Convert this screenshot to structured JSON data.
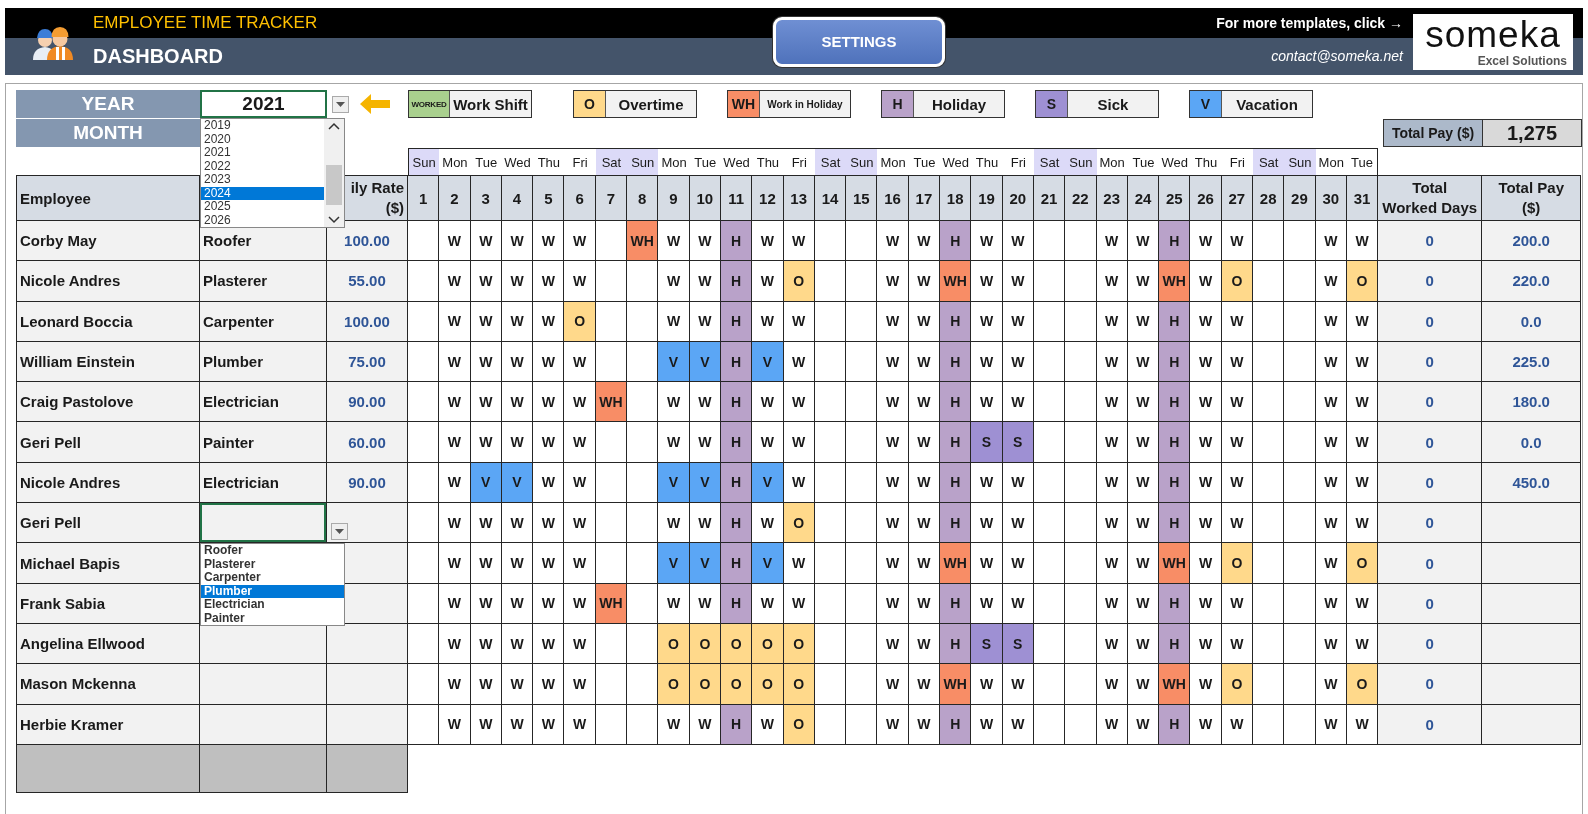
{
  "header": {
    "title": "EMPLOYEE TIME TRACKER",
    "subtitle": "DASHBOARD",
    "settings_button": "SETTINGS",
    "templates_link": "For more templates, click →",
    "contact": "contact@someka.net",
    "logo": {
      "name": "someka",
      "tagline": "Excel Solutions"
    }
  },
  "filters": {
    "year_label": "YEAR",
    "year_value": "2021",
    "month_label": "MONTH",
    "year_dropdown": {
      "options": [
        {
          "label": "2019",
          "selected": false
        },
        {
          "label": "2020",
          "selected": false
        },
        {
          "label": "2021",
          "selected": false
        },
        {
          "label": "2022",
          "selected": false
        },
        {
          "label": "2023",
          "selected": false
        },
        {
          "label": "2024",
          "selected": true
        },
        {
          "label": "2025",
          "selected": false
        },
        {
          "label": "2026",
          "selected": false
        }
      ]
    }
  },
  "legend": [
    {
      "kind": "work",
      "code": "WORKED",
      "label": "Work Shift",
      "color": "#a9d08e"
    },
    {
      "kind": "overtime",
      "code": "O",
      "label": "Overtime",
      "color": "#ffd98b"
    },
    {
      "kind": "work_holiday",
      "code": "WH",
      "label": "Work in Holiday",
      "color": "#f88d66"
    },
    {
      "kind": "holiday",
      "code": "H",
      "label": "Holiday",
      "color": "#b9a2c9"
    },
    {
      "kind": "sick",
      "code": "S",
      "label": "Sick",
      "color": "#9e90d3"
    },
    {
      "kind": "vacation",
      "code": "V",
      "label": "Vacation",
      "color": "#5ba6f5"
    }
  ],
  "total_pay": {
    "label": "Total Pay ($)",
    "value": "1,275"
  },
  "table": {
    "columns": {
      "employee": "Employee",
      "daily_rate": [
        "ily Rate",
        "($)"
      ],
      "total_worked_days": [
        "Total",
        "Worked Days"
      ],
      "total_pay": [
        "Total Pay",
        "($)"
      ]
    },
    "days": [
      {
        "weekday": "Sun",
        "number": "1",
        "weekend": true
      },
      {
        "weekday": "Mon",
        "number": "2",
        "weekend": false
      },
      {
        "weekday": "Tue",
        "number": "3",
        "weekend": false
      },
      {
        "weekday": "Wed",
        "number": "4",
        "weekend": false
      },
      {
        "weekday": "Thu",
        "number": "5",
        "weekend": false
      },
      {
        "weekday": "Fri",
        "number": "6",
        "weekend": false
      },
      {
        "weekday": "Sat",
        "number": "7",
        "weekend": true
      },
      {
        "weekday": "Sun",
        "number": "8",
        "weekend": true
      },
      {
        "weekday": "Mon",
        "number": "9",
        "weekend": false
      },
      {
        "weekday": "Tue",
        "number": "10",
        "weekend": false
      },
      {
        "weekday": "Wed",
        "number": "11",
        "weekend": false
      },
      {
        "weekday": "Thu",
        "number": "12",
        "weekend": false
      },
      {
        "weekday": "Fri",
        "number": "13",
        "weekend": false
      },
      {
        "weekday": "Sat",
        "number": "14",
        "weekend": true
      },
      {
        "weekday": "Sun",
        "number": "15",
        "weekend": true
      },
      {
        "weekday": "Mon",
        "number": "16",
        "weekend": false
      },
      {
        "weekday": "Tue",
        "number": "17",
        "weekend": false
      },
      {
        "weekday": "Wed",
        "number": "18",
        "weekend": false
      },
      {
        "weekday": "Thu",
        "number": "19",
        "weekend": false
      },
      {
        "weekday": "Fri",
        "number": "20",
        "weekend": false
      },
      {
        "weekday": "Sat",
        "number": "21",
        "weekend": true
      },
      {
        "weekday": "Sun",
        "number": "22",
        "weekend": true
      },
      {
        "weekday": "Mon",
        "number": "23",
        "weekend": false
      },
      {
        "weekday": "Tue",
        "number": "24",
        "weekend": false
      },
      {
        "weekday": "Wed",
        "number": "25",
        "weekend": false
      },
      {
        "weekday": "Thu",
        "number": "26",
        "weekend": false
      },
      {
        "weekday": "Fri",
        "number": "27",
        "weekend": false
      },
      {
        "weekday": "Sat",
        "number": "28",
        "weekend": true
      },
      {
        "weekday": "Sun",
        "number": "29",
        "weekend": true
      },
      {
        "weekday": "Mon",
        "number": "30",
        "weekend": false
      },
      {
        "weekday": "Tue",
        "number": "31",
        "weekend": false
      }
    ],
    "rows": [
      {
        "employee": "Corby May",
        "job": "Roofer",
        "daily_rate": "100.00",
        "total_worked_days": "0",
        "total_pay": "200.0",
        "days": [
          {
            "kind": "empty"
          },
          {
            "kind": "work",
            "text": "W"
          },
          {
            "kind": "work",
            "text": "W"
          },
          {
            "kind": "work",
            "text": "W"
          },
          {
            "kind": "work",
            "text": "W"
          },
          {
            "kind": "work",
            "text": "W"
          },
          {
            "kind": "empty"
          },
          {
            "kind": "work_holiday",
            "text": "WH"
          },
          {
            "kind": "work",
            "text": "W"
          },
          {
            "kind": "work",
            "text": "W"
          },
          {
            "kind": "holiday",
            "text": "H"
          },
          {
            "kind": "work",
            "text": "W"
          },
          {
            "kind": "work",
            "text": "W"
          },
          {
            "kind": "empty"
          },
          {
            "kind": "empty"
          },
          {
            "kind": "work",
            "text": "W"
          },
          {
            "kind": "work",
            "text": "W"
          },
          {
            "kind": "holiday",
            "text": "H"
          },
          {
            "kind": "work",
            "text": "W"
          },
          {
            "kind": "work",
            "text": "W"
          },
          {
            "kind": "empty"
          },
          {
            "kind": "empty"
          },
          {
            "kind": "work",
            "text": "W"
          },
          {
            "kind": "work",
            "text": "W"
          },
          {
            "kind": "holiday",
            "text": "H"
          },
          {
            "kind": "work",
            "text": "W"
          },
          {
            "kind": "work",
            "text": "W"
          },
          {
            "kind": "empty"
          },
          {
            "kind": "empty"
          },
          {
            "kind": "work",
            "text": "W"
          },
          {
            "kind": "work",
            "text": "W"
          }
        ]
      },
      {
        "employee": "Nicole Andres",
        "job": "Plasterer",
        "daily_rate": "55.00",
        "total_worked_days": "0",
        "total_pay": "220.0",
        "days": [
          {
            "kind": "empty"
          },
          {
            "kind": "work",
            "text": "W"
          },
          {
            "kind": "work",
            "text": "W"
          },
          {
            "kind": "work",
            "text": "W"
          },
          {
            "kind": "work",
            "text": "W"
          },
          {
            "kind": "work",
            "text": "W"
          },
          {
            "kind": "empty"
          },
          {
            "kind": "empty"
          },
          {
            "kind": "work",
            "text": "W"
          },
          {
            "kind": "work",
            "text": "W"
          },
          {
            "kind": "holiday",
            "text": "H"
          },
          {
            "kind": "work",
            "text": "W"
          },
          {
            "kind": "overtime",
            "text": "O"
          },
          {
            "kind": "empty"
          },
          {
            "kind": "empty"
          },
          {
            "kind": "work",
            "text": "W"
          },
          {
            "kind": "work",
            "text": "W"
          },
          {
            "kind": "work_holiday",
            "text": "WH"
          },
          {
            "kind": "work",
            "text": "W"
          },
          {
            "kind": "work",
            "text": "W"
          },
          {
            "kind": "empty"
          },
          {
            "kind": "empty"
          },
          {
            "kind": "work",
            "text": "W"
          },
          {
            "kind": "work",
            "text": "W"
          },
          {
            "kind": "work_holiday",
            "text": "WH"
          },
          {
            "kind": "work",
            "text": "W"
          },
          {
            "kind": "overtime",
            "text": "O"
          },
          {
            "kind": "empty"
          },
          {
            "kind": "empty"
          },
          {
            "kind": "work",
            "text": "W"
          },
          {
            "kind": "overtime",
            "text": "O"
          }
        ]
      },
      {
        "employee": "Leonard Boccia",
        "job": "Carpenter",
        "daily_rate": "100.00",
        "total_worked_days": "0",
        "total_pay": "0.0",
        "days": [
          {
            "kind": "empty"
          },
          {
            "kind": "work",
            "text": "W"
          },
          {
            "kind": "work",
            "text": "W"
          },
          {
            "kind": "work",
            "text": "W"
          },
          {
            "kind": "work",
            "text": "W"
          },
          {
            "kind": "overtime",
            "text": "O"
          },
          {
            "kind": "empty"
          },
          {
            "kind": "empty"
          },
          {
            "kind": "work",
            "text": "W"
          },
          {
            "kind": "work",
            "text": "W"
          },
          {
            "kind": "holiday",
            "text": "H"
          },
          {
            "kind": "work",
            "text": "W"
          },
          {
            "kind": "work",
            "text": "W"
          },
          {
            "kind": "empty"
          },
          {
            "kind": "empty"
          },
          {
            "kind": "work",
            "text": "W"
          },
          {
            "kind": "work",
            "text": "W"
          },
          {
            "kind": "holiday",
            "text": "H"
          },
          {
            "kind": "work",
            "text": "W"
          },
          {
            "kind": "work",
            "text": "W"
          },
          {
            "kind": "empty"
          },
          {
            "kind": "empty"
          },
          {
            "kind": "work",
            "text": "W"
          },
          {
            "kind": "work",
            "text": "W"
          },
          {
            "kind": "holiday",
            "text": "H"
          },
          {
            "kind": "work",
            "text": "W"
          },
          {
            "kind": "work",
            "text": "W"
          },
          {
            "kind": "empty"
          },
          {
            "kind": "empty"
          },
          {
            "kind": "work",
            "text": "W"
          },
          {
            "kind": "work",
            "text": "W"
          }
        ]
      },
      {
        "employee": "William Einstein",
        "job": "Plumber",
        "daily_rate": "75.00",
        "total_worked_days": "0",
        "total_pay": "225.0",
        "days": [
          {
            "kind": "empty"
          },
          {
            "kind": "work",
            "text": "W"
          },
          {
            "kind": "work",
            "text": "W"
          },
          {
            "kind": "work",
            "text": "W"
          },
          {
            "kind": "work",
            "text": "W"
          },
          {
            "kind": "work",
            "text": "W"
          },
          {
            "kind": "empty"
          },
          {
            "kind": "empty"
          },
          {
            "kind": "vacation",
            "text": "V"
          },
          {
            "kind": "vacation",
            "text": "V"
          },
          {
            "kind": "holiday",
            "text": "H"
          },
          {
            "kind": "vacation",
            "text": "V"
          },
          {
            "kind": "work",
            "text": "W"
          },
          {
            "kind": "empty"
          },
          {
            "kind": "empty"
          },
          {
            "kind": "work",
            "text": "W"
          },
          {
            "kind": "work",
            "text": "W"
          },
          {
            "kind": "holiday",
            "text": "H"
          },
          {
            "kind": "work",
            "text": "W"
          },
          {
            "kind": "work",
            "text": "W"
          },
          {
            "kind": "empty"
          },
          {
            "kind": "empty"
          },
          {
            "kind": "work",
            "text": "W"
          },
          {
            "kind": "work",
            "text": "W"
          },
          {
            "kind": "holiday",
            "text": "H"
          },
          {
            "kind": "work",
            "text": "W"
          },
          {
            "kind": "work",
            "text": "W"
          },
          {
            "kind": "empty"
          },
          {
            "kind": "empty"
          },
          {
            "kind": "work",
            "text": "W"
          },
          {
            "kind": "work",
            "text": "W"
          }
        ]
      },
      {
        "employee": "Craig Pastolove",
        "job": "Electrician",
        "daily_rate": "90.00",
        "total_worked_days": "0",
        "total_pay": "180.0",
        "days": [
          {
            "kind": "empty"
          },
          {
            "kind": "work",
            "text": "W"
          },
          {
            "kind": "work",
            "text": "W"
          },
          {
            "kind": "work",
            "text": "W"
          },
          {
            "kind": "work",
            "text": "W"
          },
          {
            "kind": "work",
            "text": "W"
          },
          {
            "kind": "work_holiday",
            "text": "WH"
          },
          {
            "kind": "empty"
          },
          {
            "kind": "work",
            "text": "W"
          },
          {
            "kind": "work",
            "text": "W"
          },
          {
            "kind": "holiday",
            "text": "H"
          },
          {
            "kind": "work",
            "text": "W"
          },
          {
            "kind": "work",
            "text": "W"
          },
          {
            "kind": "empty"
          },
          {
            "kind": "empty"
          },
          {
            "kind": "work",
            "text": "W"
          },
          {
            "kind": "work",
            "text": "W"
          },
          {
            "kind": "holiday",
            "text": "H"
          },
          {
            "kind": "work",
            "text": "W"
          },
          {
            "kind": "work",
            "text": "W"
          },
          {
            "kind": "empty"
          },
          {
            "kind": "empty"
          },
          {
            "kind": "work",
            "text": "W"
          },
          {
            "kind": "work",
            "text": "W"
          },
          {
            "kind": "holiday",
            "text": "H"
          },
          {
            "kind": "work",
            "text": "W"
          },
          {
            "kind": "work",
            "text": "W"
          },
          {
            "kind": "empty"
          },
          {
            "kind": "empty"
          },
          {
            "kind": "work",
            "text": "W"
          },
          {
            "kind": "work",
            "text": "W"
          }
        ]
      },
      {
        "employee": "Geri Pell",
        "job": "Painter",
        "daily_rate": "60.00",
        "total_worked_days": "0",
        "total_pay": "0.0",
        "days": [
          {
            "kind": "empty"
          },
          {
            "kind": "work",
            "text": "W"
          },
          {
            "kind": "work",
            "text": "W"
          },
          {
            "kind": "work",
            "text": "W"
          },
          {
            "kind": "work",
            "text": "W"
          },
          {
            "kind": "work",
            "text": "W"
          },
          {
            "kind": "empty"
          },
          {
            "kind": "empty"
          },
          {
            "kind": "work",
            "text": "W"
          },
          {
            "kind": "work",
            "text": "W"
          },
          {
            "kind": "holiday",
            "text": "H"
          },
          {
            "kind": "work",
            "text": "W"
          },
          {
            "kind": "work",
            "text": "W"
          },
          {
            "kind": "empty"
          },
          {
            "kind": "empty"
          },
          {
            "kind": "work",
            "text": "W"
          },
          {
            "kind": "work",
            "text": "W"
          },
          {
            "kind": "holiday",
            "text": "H"
          },
          {
            "kind": "sick",
            "text": "S"
          },
          {
            "kind": "sick",
            "text": "S"
          },
          {
            "kind": "empty"
          },
          {
            "kind": "empty"
          },
          {
            "kind": "work",
            "text": "W"
          },
          {
            "kind": "work",
            "text": "W"
          },
          {
            "kind": "holiday",
            "text": "H"
          },
          {
            "kind": "work",
            "text": "W"
          },
          {
            "kind": "work",
            "text": "W"
          },
          {
            "kind": "empty"
          },
          {
            "kind": "empty"
          },
          {
            "kind": "work",
            "text": "W"
          },
          {
            "kind": "work",
            "text": "W"
          }
        ]
      },
      {
        "employee": "Nicole Andres",
        "job": "Electrician",
        "daily_rate": "90.00",
        "total_worked_days": "0",
        "total_pay": "450.0",
        "days": [
          {
            "kind": "empty"
          },
          {
            "kind": "work",
            "text": "W"
          },
          {
            "kind": "vacation",
            "text": "V"
          },
          {
            "kind": "vacation",
            "text": "V"
          },
          {
            "kind": "work",
            "text": "W"
          },
          {
            "kind": "work",
            "text": "W"
          },
          {
            "kind": "empty"
          },
          {
            "kind": "empty"
          },
          {
            "kind": "vacation",
            "text": "V"
          },
          {
            "kind": "vacation",
            "text": "V"
          },
          {
            "kind": "holiday",
            "text": "H"
          },
          {
            "kind": "vacation",
            "text": "V"
          },
          {
            "kind": "work",
            "text": "W"
          },
          {
            "kind": "empty"
          },
          {
            "kind": "empty"
          },
          {
            "kind": "work",
            "text": "W"
          },
          {
            "kind": "work",
            "text": "W"
          },
          {
            "kind": "holiday",
            "text": "H"
          },
          {
            "kind": "work",
            "text": "W"
          },
          {
            "kind": "work",
            "text": "W"
          },
          {
            "kind": "empty"
          },
          {
            "kind": "empty"
          },
          {
            "kind": "work",
            "text": "W"
          },
          {
            "kind": "work",
            "text": "W"
          },
          {
            "kind": "holiday",
            "text": "H"
          },
          {
            "kind": "work",
            "text": "W"
          },
          {
            "kind": "work",
            "text": "W"
          },
          {
            "kind": "empty"
          },
          {
            "kind": "empty"
          },
          {
            "kind": "work",
            "text": "W"
          },
          {
            "kind": "work",
            "text": "W"
          }
        ]
      },
      {
        "employee": "Geri Pell",
        "total_worked_days": "0",
        "job_dropdown": {
          "options": [
            {
              "label": "Roofer",
              "selected": false
            },
            {
              "label": "Plasterer",
              "selected": false
            },
            {
              "label": "Carpenter",
              "selected": false
            },
            {
              "label": "Plumber",
              "selected": true
            },
            {
              "label": "Electrician",
              "selected": false
            },
            {
              "label": "Painter",
              "selected": false
            }
          ]
        },
        "days": [
          {
            "kind": "empty"
          },
          {
            "kind": "work",
            "text": "W"
          },
          {
            "kind": "work",
            "text": "W"
          },
          {
            "kind": "work",
            "text": "W"
          },
          {
            "kind": "work",
            "text": "W"
          },
          {
            "kind": "work",
            "text": "W"
          },
          {
            "kind": "empty"
          },
          {
            "kind": "empty"
          },
          {
            "kind": "work",
            "text": "W"
          },
          {
            "kind": "work",
            "text": "W"
          },
          {
            "kind": "holiday",
            "text": "H"
          },
          {
            "kind": "work",
            "text": "W"
          },
          {
            "kind": "overtime",
            "text": "O"
          },
          {
            "kind": "empty"
          },
          {
            "kind": "empty"
          },
          {
            "kind": "work",
            "text": "W"
          },
          {
            "kind": "work",
            "text": "W"
          },
          {
            "kind": "holiday",
            "text": "H"
          },
          {
            "kind": "work",
            "text": "W"
          },
          {
            "kind": "work",
            "text": "W"
          },
          {
            "kind": "empty"
          },
          {
            "kind": "empty"
          },
          {
            "kind": "work",
            "text": "W"
          },
          {
            "kind": "work",
            "text": "W"
          },
          {
            "kind": "holiday",
            "text": "H"
          },
          {
            "kind": "work",
            "text": "W"
          },
          {
            "kind": "work",
            "text": "W"
          },
          {
            "kind": "empty"
          },
          {
            "kind": "empty"
          },
          {
            "kind": "work",
            "text": "W"
          },
          {
            "kind": "work",
            "text": "W"
          }
        ]
      },
      {
        "employee": "Michael Bapis",
        "total_worked_days": "0",
        "days": [
          {
            "kind": "empty"
          },
          {
            "kind": "work",
            "text": "W"
          },
          {
            "kind": "work",
            "text": "W"
          },
          {
            "kind": "work",
            "text": "W"
          },
          {
            "kind": "work",
            "text": "W"
          },
          {
            "kind": "work",
            "text": "W"
          },
          {
            "kind": "empty"
          },
          {
            "kind": "empty"
          },
          {
            "kind": "vacation",
            "text": "V"
          },
          {
            "kind": "vacation",
            "text": "V"
          },
          {
            "kind": "holiday",
            "text": "H"
          },
          {
            "kind": "vacation",
            "text": "V"
          },
          {
            "kind": "work",
            "text": "W"
          },
          {
            "kind": "empty"
          },
          {
            "kind": "empty"
          },
          {
            "kind": "work",
            "text": "W"
          },
          {
            "kind": "work",
            "text": "W"
          },
          {
            "kind": "work_holiday",
            "text": "WH"
          },
          {
            "kind": "work",
            "text": "W"
          },
          {
            "kind": "work",
            "text": "W"
          },
          {
            "kind": "empty"
          },
          {
            "kind": "empty"
          },
          {
            "kind": "work",
            "text": "W"
          },
          {
            "kind": "work",
            "text": "W"
          },
          {
            "kind": "work_holiday",
            "text": "WH"
          },
          {
            "kind": "work",
            "text": "W"
          },
          {
            "kind": "overtime",
            "text": "O"
          },
          {
            "kind": "empty"
          },
          {
            "kind": "empty"
          },
          {
            "kind": "work",
            "text": "W"
          },
          {
            "kind": "overtime",
            "text": "O"
          }
        ]
      },
      {
        "employee": "Frank Sabia",
        "total_worked_days": "0",
        "days": [
          {
            "kind": "empty"
          },
          {
            "kind": "work",
            "text": "W"
          },
          {
            "kind": "work",
            "text": "W"
          },
          {
            "kind": "work",
            "text": "W"
          },
          {
            "kind": "work",
            "text": "W"
          },
          {
            "kind": "work",
            "text": "W"
          },
          {
            "kind": "work_holiday",
            "text": "WH"
          },
          {
            "kind": "empty"
          },
          {
            "kind": "work",
            "text": "W"
          },
          {
            "kind": "work",
            "text": "W"
          },
          {
            "kind": "holiday",
            "text": "H"
          },
          {
            "kind": "work",
            "text": "W"
          },
          {
            "kind": "work",
            "text": "W"
          },
          {
            "kind": "empty"
          },
          {
            "kind": "empty"
          },
          {
            "kind": "work",
            "text": "W"
          },
          {
            "kind": "work",
            "text": "W"
          },
          {
            "kind": "holiday",
            "text": "H"
          },
          {
            "kind": "work",
            "text": "W"
          },
          {
            "kind": "work",
            "text": "W"
          },
          {
            "kind": "empty"
          },
          {
            "kind": "empty"
          },
          {
            "kind": "work",
            "text": "W"
          },
          {
            "kind": "work",
            "text": "W"
          },
          {
            "kind": "holiday",
            "text": "H"
          },
          {
            "kind": "work",
            "text": "W"
          },
          {
            "kind": "work",
            "text": "W"
          },
          {
            "kind": "empty"
          },
          {
            "kind": "empty"
          },
          {
            "kind": "work",
            "text": "W"
          },
          {
            "kind": "work",
            "text": "W"
          }
        ]
      },
      {
        "employee": "Angelina Ellwood",
        "total_worked_days": "0",
        "days": [
          {
            "kind": "empty"
          },
          {
            "kind": "work",
            "text": "W"
          },
          {
            "kind": "work",
            "text": "W"
          },
          {
            "kind": "work",
            "text": "W"
          },
          {
            "kind": "work",
            "text": "W"
          },
          {
            "kind": "work",
            "text": "W"
          },
          {
            "kind": "empty"
          },
          {
            "kind": "empty"
          },
          {
            "kind": "overtime",
            "text": "O"
          },
          {
            "kind": "overtime",
            "text": "O"
          },
          {
            "kind": "overtime",
            "text": "O"
          },
          {
            "kind": "overtime",
            "text": "O"
          },
          {
            "kind": "overtime",
            "text": "O"
          },
          {
            "kind": "empty"
          },
          {
            "kind": "empty"
          },
          {
            "kind": "work",
            "text": "W"
          },
          {
            "kind": "work",
            "text": "W"
          },
          {
            "kind": "holiday",
            "text": "H"
          },
          {
            "kind": "sick",
            "text": "S"
          },
          {
            "kind": "sick",
            "text": "S"
          },
          {
            "kind": "empty"
          },
          {
            "kind": "empty"
          },
          {
            "kind": "work",
            "text": "W"
          },
          {
            "kind": "work",
            "text": "W"
          },
          {
            "kind": "holiday",
            "text": "H"
          },
          {
            "kind": "work",
            "text": "W"
          },
          {
            "kind": "work",
            "text": "W"
          },
          {
            "kind": "empty"
          },
          {
            "kind": "empty"
          },
          {
            "kind": "work",
            "text": "W"
          },
          {
            "kind": "work",
            "text": "W"
          }
        ]
      },
      {
        "employee": "Mason Mckenna",
        "total_worked_days": "0",
        "days": [
          {
            "kind": "empty"
          },
          {
            "kind": "work",
            "text": "W"
          },
          {
            "kind": "work",
            "text": "W"
          },
          {
            "kind": "work",
            "text": "W"
          },
          {
            "kind": "work",
            "text": "W"
          },
          {
            "kind": "work",
            "text": "W"
          },
          {
            "kind": "empty"
          },
          {
            "kind": "empty"
          },
          {
            "kind": "overtime",
            "text": "O"
          },
          {
            "kind": "overtime",
            "text": "O"
          },
          {
            "kind": "overtime",
            "text": "O"
          },
          {
            "kind": "overtime",
            "text": "O"
          },
          {
            "kind": "overtime",
            "text": "O"
          },
          {
            "kind": "empty"
          },
          {
            "kind": "empty"
          },
          {
            "kind": "work",
            "text": "W"
          },
          {
            "kind": "work",
            "text": "W"
          },
          {
            "kind": "work_holiday",
            "text": "WH"
          },
          {
            "kind": "work",
            "text": "W"
          },
          {
            "kind": "work",
            "text": "W"
          },
          {
            "kind": "empty"
          },
          {
            "kind": "empty"
          },
          {
            "kind": "work",
            "text": "W"
          },
          {
            "kind": "work",
            "text": "W"
          },
          {
            "kind": "work_holiday",
            "text": "WH"
          },
          {
            "kind": "work",
            "text": "W"
          },
          {
            "kind": "overtime",
            "text": "O"
          },
          {
            "kind": "empty"
          },
          {
            "kind": "empty"
          },
          {
            "kind": "work",
            "text": "W"
          },
          {
            "kind": "overtime",
            "text": "O"
          }
        ]
      },
      {
        "employee": "Herbie Kramer",
        "total_worked_days": "0",
        "days": [
          {
            "kind": "empty"
          },
          {
            "kind": "work",
            "text": "W"
          },
          {
            "kind": "work",
            "text": "W"
          },
          {
            "kind": "work",
            "text": "W"
          },
          {
            "kind": "work",
            "text": "W"
          },
          {
            "kind": "work",
            "text": "W"
          },
          {
            "kind": "empty"
          },
          {
            "kind": "empty"
          },
          {
            "kind": "work",
            "text": "W"
          },
          {
            "kind": "work",
            "text": "W"
          },
          {
            "kind": "holiday",
            "text": "H"
          },
          {
            "kind": "work",
            "text": "W"
          },
          {
            "kind": "overtime",
            "text": "O"
          },
          {
            "kind": "empty"
          },
          {
            "kind": "empty"
          },
          {
            "kind": "work",
            "text": "W"
          },
          {
            "kind": "work",
            "text": "W"
          },
          {
            "kind": "holiday",
            "text": "H"
          },
          {
            "kind": "work",
            "text": "W"
          },
          {
            "kind": "work",
            "text": "W"
          },
          {
            "kind": "empty"
          },
          {
            "kind": "empty"
          },
          {
            "kind": "work",
            "text": "W"
          },
          {
            "kind": "work",
            "text": "W"
          },
          {
            "kind": "holiday",
            "text": "H"
          },
          {
            "kind": "work",
            "text": "W"
          },
          {
            "kind": "work",
            "text": "W"
          },
          {
            "kind": "empty"
          },
          {
            "kind": "empty"
          },
          {
            "kind": "work",
            "text": "W"
          },
          {
            "kind": "work",
            "text": "W"
          }
        ]
      }
    ]
  }
}
